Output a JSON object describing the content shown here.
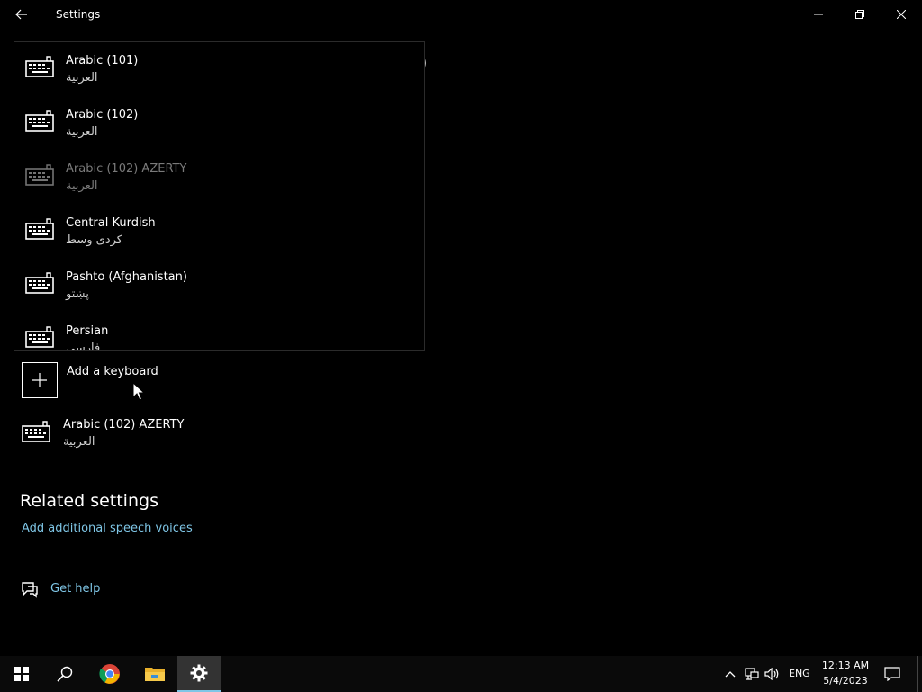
{
  "window": {
    "title": "Settings"
  },
  "header_paren": ")",
  "dropdown": {
    "items": [
      {
        "name": "Arabic (101)",
        "native": "العربية",
        "enabled": true
      },
      {
        "name": "Arabic (102)",
        "native": "العربية",
        "enabled": true
      },
      {
        "name": "Arabic (102) AZERTY",
        "native": "العربية",
        "enabled": false
      },
      {
        "name": "Central Kurdish",
        "native": "کردی وسط",
        "enabled": true
      },
      {
        "name": "Pashto (Afghanistan)",
        "native": "پښتو",
        "enabled": true
      },
      {
        "name": "Persian",
        "native": "فارسی",
        "enabled": true
      }
    ]
  },
  "add_keyboard": {
    "label": "Add a keyboard"
  },
  "installed_keyboard": {
    "name": "Arabic (102) AZERTY",
    "native": "العربية"
  },
  "related": {
    "heading": "Related settings",
    "link": "Add additional speech voices"
  },
  "help": {
    "label": "Get help"
  },
  "taskbar": {
    "lang": "ENG",
    "time": "12:13 AM",
    "date": "5/4/2023",
    "accent": "#7fc6e6"
  }
}
